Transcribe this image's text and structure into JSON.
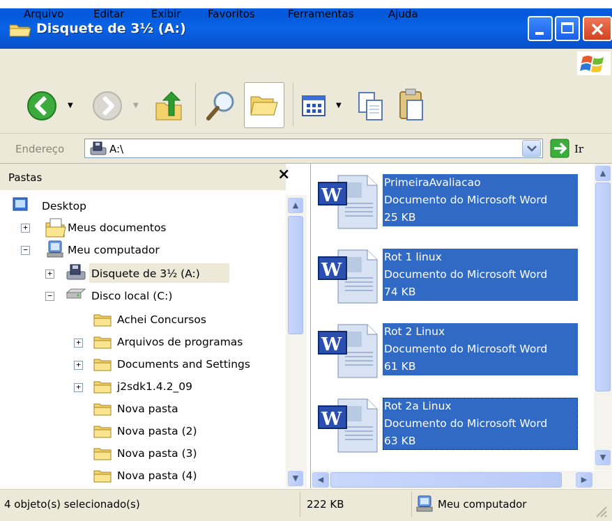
{
  "window": {
    "title": "Disquete de 3½ (A:)"
  },
  "menu": [
    "Arquivo",
    "Editar",
    "Exibir",
    "Favoritos",
    "Ferramentas",
    "Ajuda"
  ],
  "address": {
    "label": "Endereço",
    "value": "A:\\",
    "go_label": "Ir"
  },
  "folders": {
    "header": "Pastas",
    "close_glyph": "×",
    "tree": [
      {
        "label": "Desktop"
      },
      {
        "label": "Meus documentos"
      },
      {
        "label": "Meu computador"
      },
      {
        "label": "Disquete de 3½ (A:)"
      },
      {
        "label": "Disco local (C:)"
      },
      {
        "label": "Achei Concursos"
      },
      {
        "label": "Arquivos de programas"
      },
      {
        "label": "Documents and Settings"
      },
      {
        "label": "j2sdk1.4.2_09"
      },
      {
        "label": "Nova pasta"
      },
      {
        "label": "Nova pasta (2)"
      },
      {
        "label": "Nova pasta (3)"
      },
      {
        "label": "Nova pasta (4)"
      }
    ]
  },
  "files": [
    {
      "name": "PrimeiraAvaliacao",
      "type": "Documento do Microsoft Word",
      "size": "25 KB"
    },
    {
      "name": "Rot 1 linux",
      "type": "Documento do Microsoft Word",
      "size": "74 KB"
    },
    {
      "name": "Rot 2 Linux",
      "type": "Documento do Microsoft Word",
      "size": "61 KB"
    },
    {
      "name": "Rot 2a Linux",
      "type": "Documento do Microsoft Word",
      "size": "63 KB"
    }
  ],
  "status": {
    "selection": "4 objeto(s) selecionado(s)",
    "size": "222 KB",
    "zone": "Meu computador"
  },
  "icons": [
    "folder-icon",
    "word-document-icon",
    "back-icon",
    "forward-icon",
    "up-folder-icon",
    "search-icon",
    "folders-view-icon",
    "views-icon",
    "copy-icon",
    "paste-icon",
    "floppy-drive-icon",
    "computer-icon"
  ],
  "colors": {
    "titlebar": "#0a5de0",
    "selection": "#316ac5",
    "chrome": "#ece9d8",
    "close": "#d2431f"
  }
}
